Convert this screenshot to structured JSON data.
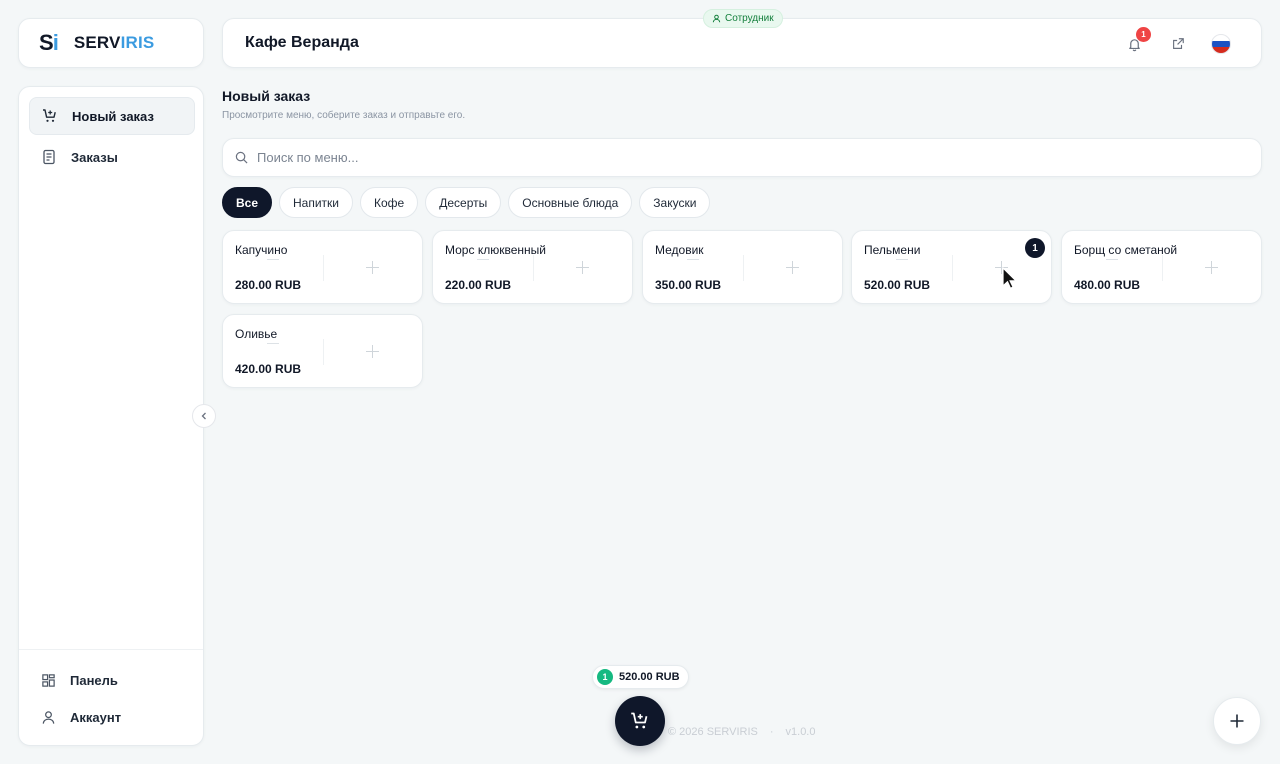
{
  "brand": {
    "mark_s": "S",
    "mark_i": "i",
    "word_dark": "SERV",
    "word_blue": "IRIS"
  },
  "header": {
    "title": "Кафе Веранда",
    "role_badge": "Сотрудник",
    "notification_count": "1"
  },
  "sidebar": {
    "items": [
      {
        "label": "Новый заказ",
        "icon": "cart-plus-icon"
      },
      {
        "label": "Заказы",
        "icon": "receipt-icon"
      }
    ],
    "bottom_items": [
      {
        "label": "Панель",
        "icon": "dashboard-icon"
      },
      {
        "label": "Аккаунт",
        "icon": "user-icon"
      }
    ]
  },
  "page": {
    "title": "Новый заказ",
    "subtitle": "Просмотрите меню, соберите заказ и отправьте его."
  },
  "search": {
    "placeholder": "Поиск по меню..."
  },
  "categories": [
    "Все",
    "Напитки",
    "Кофе",
    "Десерты",
    "Основные блюда",
    "Закуски"
  ],
  "active_category": "Все",
  "menu_items": [
    {
      "name": "Капучино",
      "price": "280.00 RUB"
    },
    {
      "name": "Морс клюквенный",
      "price": "220.00 RUB"
    },
    {
      "name": "Медовик",
      "price": "350.00 RUB"
    },
    {
      "name": "Пельмени",
      "price": "520.00 RUB",
      "qty": "1"
    },
    {
      "name": "Борщ со сметаной",
      "price": "480.00 RUB"
    },
    {
      "name": "Оливье",
      "price": "420.00 RUB"
    }
  ],
  "cart": {
    "count": "1",
    "total": "520.00 RUB"
  },
  "footer": {
    "copyright": "© 2026 SERVIRIS",
    "dot": "·",
    "version": "v1.0.0"
  },
  "colors": {
    "accent_dark": "#0f172a",
    "brand_blue": "#3b9be0",
    "success": "#16b981",
    "danger": "#ef4444"
  }
}
